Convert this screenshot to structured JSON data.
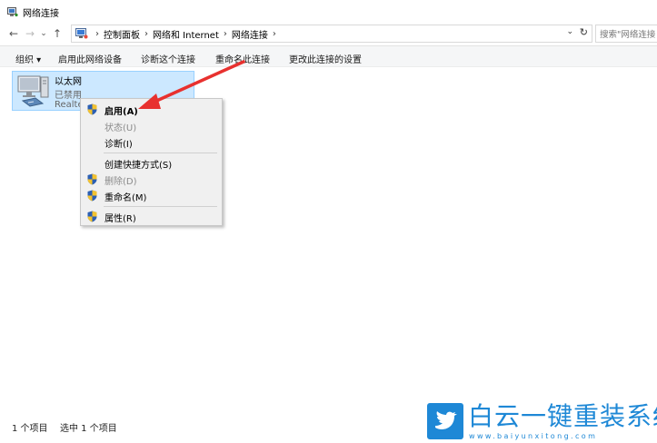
{
  "window": {
    "title": "网络连接"
  },
  "nav": {
    "back": "←",
    "forward": "→",
    "recent": "⌄",
    "up": "↑"
  },
  "address": {
    "crumbs": [
      "控制面板",
      "网络和 Internet",
      "网络连接"
    ],
    "separator": "›",
    "dropdown": "⌄",
    "refresh": "↻"
  },
  "search": {
    "placeholder": "搜索\"网络连接"
  },
  "commands": {
    "organize": "组织 ▾",
    "enable_device": "启用此网络设备",
    "diagnose": "诊断这个连接",
    "rename": "重命名此连接",
    "change_settings": "更改此连接的设置"
  },
  "connection": {
    "name": "以太网",
    "status": "已禁用",
    "adapter": "Realte"
  },
  "context_menu": {
    "items": [
      {
        "label": "启用(A)",
        "shield": true,
        "bold": true,
        "disabled": false
      },
      {
        "label": "状态(U)",
        "shield": false,
        "bold": false,
        "disabled": true
      },
      {
        "label": "诊断(I)",
        "shield": false,
        "bold": false,
        "disabled": false
      },
      {
        "label": "创建快捷方式(S)",
        "shield": false,
        "bold": false,
        "disabled": false
      },
      {
        "label": "删除(D)",
        "shield": true,
        "bold": false,
        "disabled": true
      },
      {
        "label": "重命名(M)",
        "shield": true,
        "bold": false,
        "disabled": false
      },
      {
        "label": "属性(R)",
        "shield": true,
        "bold": false,
        "disabled": false
      }
    ]
  },
  "statusbar": {
    "item_count": "1 个项目",
    "selected": "选中 1 个项目"
  },
  "watermark": {
    "brand": "白云一键重装系统",
    "url": "www.baiyunxitong.com"
  },
  "colors": {
    "selection_bg": "#cce8ff",
    "selection_border": "#99d1ff",
    "arrow": "#e8312f",
    "watermark": "#1e88d6"
  }
}
